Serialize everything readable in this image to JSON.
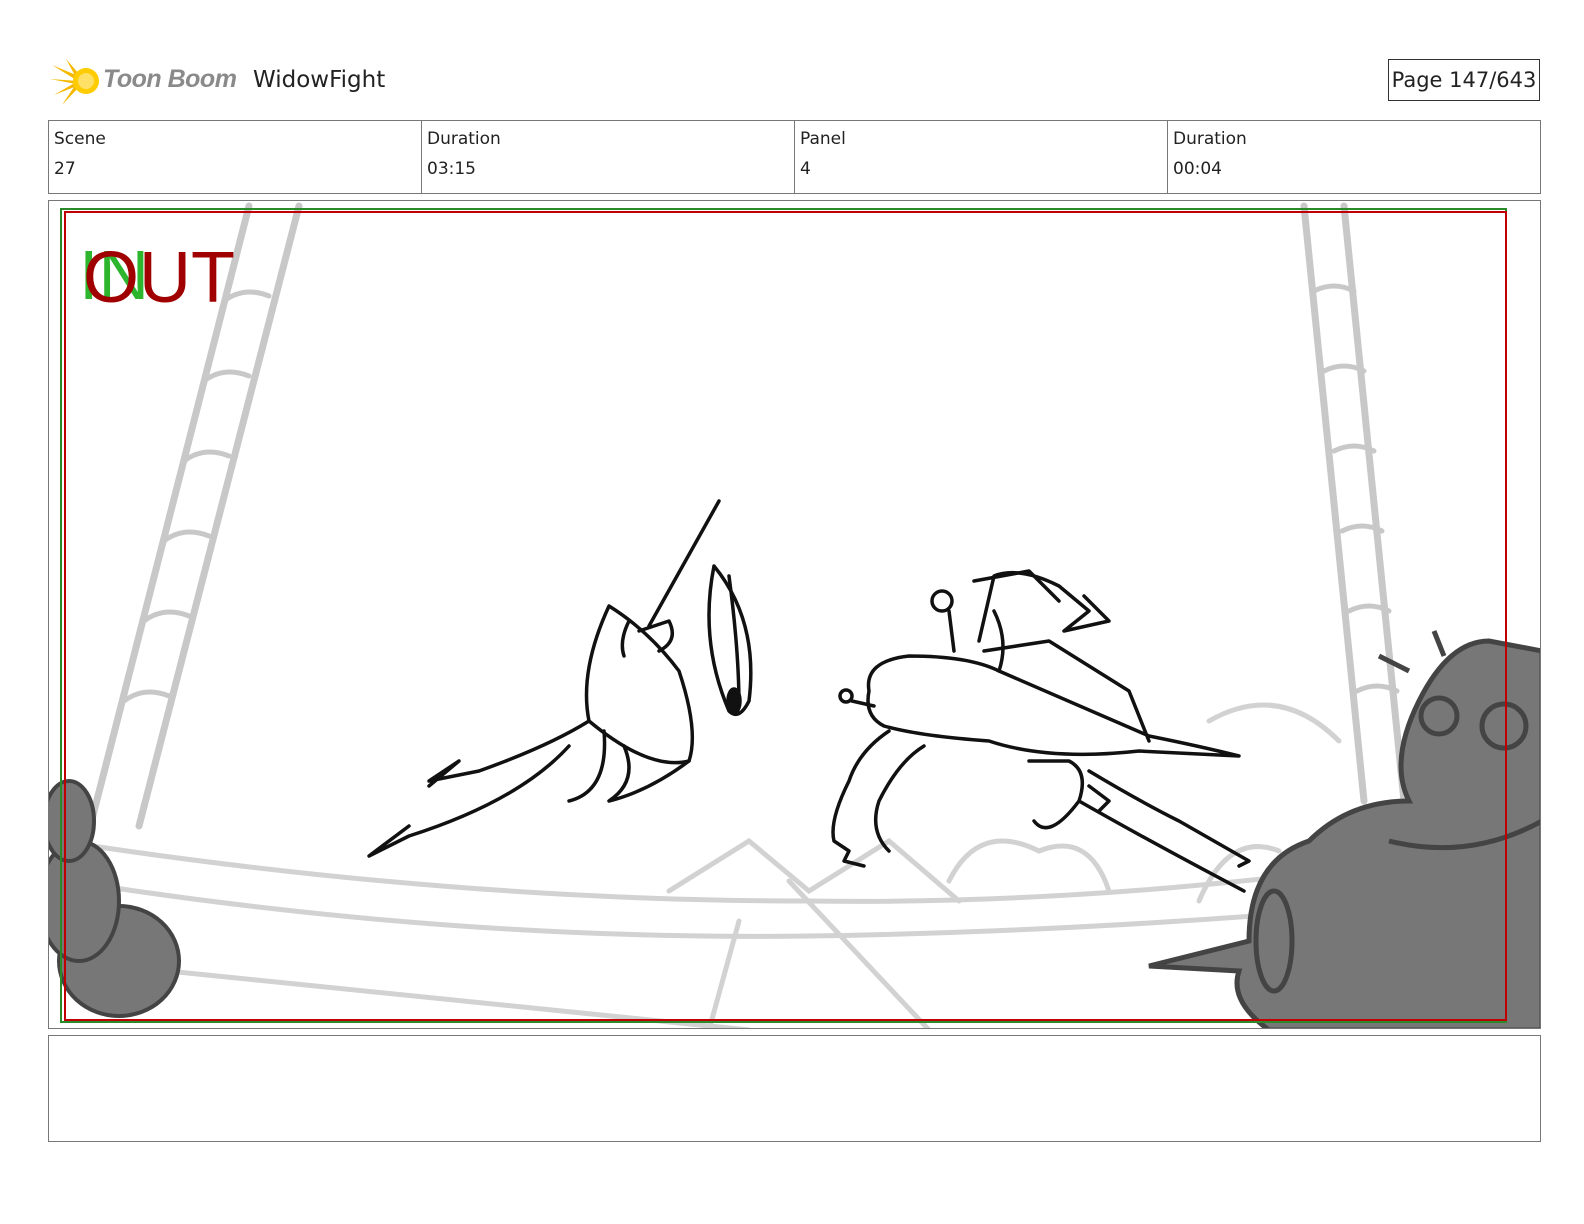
{
  "header": {
    "brand": "Toon Boom",
    "project_title": "WidowFight",
    "page_label": "Page 147/643"
  },
  "info": [
    {
      "label": "Scene",
      "value": "27"
    },
    {
      "label": "Duration",
      "value": "03:15"
    },
    {
      "label": "Panel",
      "value": "4"
    },
    {
      "label": "Duration",
      "value": "00:04"
    }
  ],
  "panel": {
    "in_marker": "IN",
    "out_marker": "OUT"
  },
  "notes": {
    "text": ""
  },
  "colors": {
    "in_marker": "#2db52d",
    "out_marker": "#a00000",
    "frame_green": "#2a8a2a",
    "frame_red": "#c00000",
    "sketch_grey": "#c8c8c8",
    "silhouette": "#777777"
  }
}
